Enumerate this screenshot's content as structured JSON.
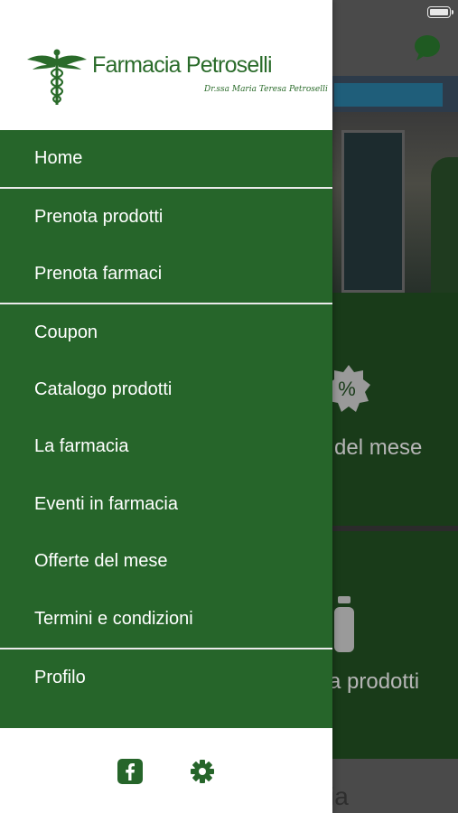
{
  "brand": {
    "name": "Farmacia Petroselli",
    "signature": "Dr.ssa Maria Teresa Petroselli",
    "color": "#2a6b2a"
  },
  "menu": {
    "items": [
      {
        "label": "Home"
      },
      {
        "label": "Prenota prodotti"
      },
      {
        "label": "Prenota farmaci"
      },
      {
        "label": "Coupon"
      },
      {
        "label": "Catalogo prodotti"
      },
      {
        "label": "La farmacia"
      },
      {
        "label": "Eventi in farmacia"
      },
      {
        "label": "Offerte del mese"
      },
      {
        "label": "Termini e condizioni"
      },
      {
        "label": "Profilo"
      }
    ],
    "background": "#26652a"
  },
  "footer": {
    "icons": [
      "facebook-icon",
      "gear-icon"
    ]
  },
  "background_app": {
    "tile1_label": "del mese",
    "tile2_label": "a prodotti",
    "bottom_label": "ia",
    "badge_symbol": "%"
  }
}
